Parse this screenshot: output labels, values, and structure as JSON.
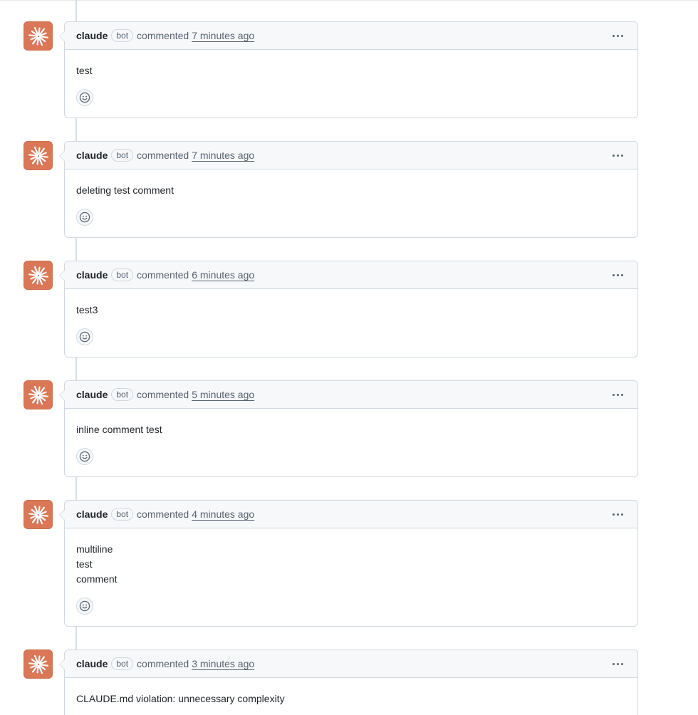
{
  "comments": [
    {
      "author": "claude",
      "badge": "bot",
      "action": "commented",
      "time": "7 minutes ago",
      "body": [
        "test"
      ]
    },
    {
      "author": "claude",
      "badge": "bot",
      "action": "commented",
      "time": "7 minutes ago",
      "body": [
        "deleting test comment"
      ]
    },
    {
      "author": "claude",
      "badge": "bot",
      "action": "commented",
      "time": "6 minutes ago",
      "body": [
        "test3"
      ]
    },
    {
      "author": "claude",
      "badge": "bot",
      "action": "commented",
      "time": "5 minutes ago",
      "body": [
        "inline comment test"
      ]
    },
    {
      "author": "claude",
      "badge": "bot",
      "action": "commented",
      "time": "4 minutes ago",
      "body": [
        "multiline",
        "test",
        "comment"
      ]
    },
    {
      "author": "claude",
      "badge": "bot",
      "action": "commented",
      "time": "3 minutes ago",
      "body": [
        "CLAUDE.md violation: unnecessary complexity"
      ]
    }
  ],
  "icons": {
    "avatar": "claude-sunburst-icon",
    "menu": "kebab-horizontal-icon",
    "reaction": "smiley-icon"
  },
  "colors": {
    "avatar_bg": "#d97757",
    "header_bg": "#f6f8fa",
    "border": "#d1d9e0",
    "muted_text": "#59636e"
  }
}
